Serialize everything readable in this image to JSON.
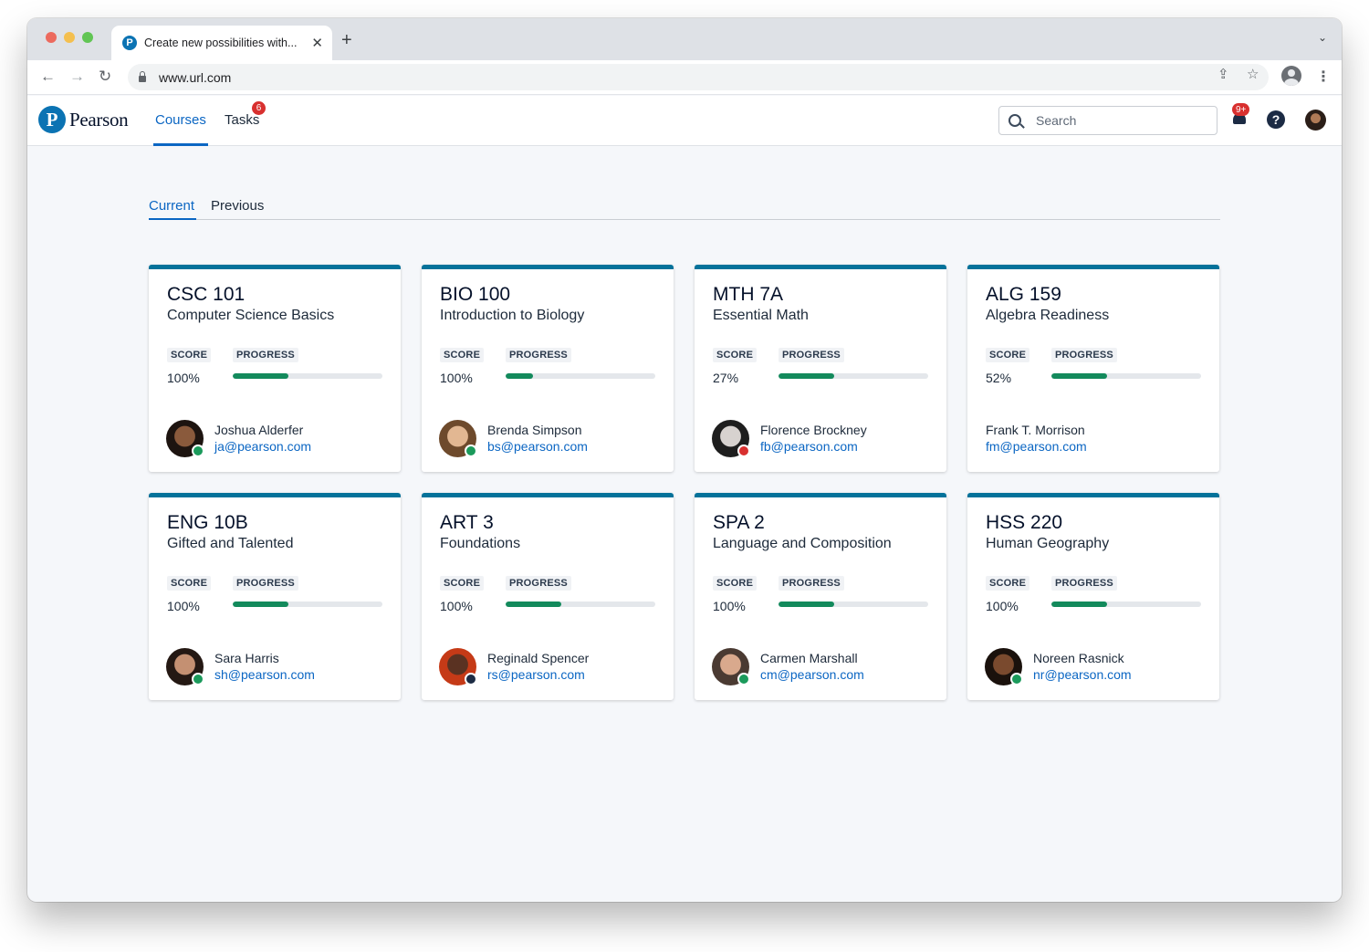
{
  "browser": {
    "tab_title": "Create new possibilities with...",
    "favicon_letter": "P",
    "url": "www.url.com"
  },
  "app": {
    "logo_mark": "P",
    "logo_text": "Pearson",
    "nav": {
      "courses": "Courses",
      "tasks": "Tasks",
      "tasks_badge": "6"
    },
    "search_placeholder": "Search",
    "notifications_badge": "9+",
    "help_glyph": "?"
  },
  "subtabs": {
    "current": "Current",
    "previous": "Previous"
  },
  "labels": {
    "score": "SCORE",
    "progress": "PROGRESS"
  },
  "colors": {
    "accent": "#0b66c3",
    "card_top": "#04729a",
    "progress": "#138a5c",
    "status_online": "#1b9a5b",
    "status_busy": "#d8302f",
    "status_away": "#1c2b44"
  },
  "courses": [
    {
      "code": "CSC 101",
      "name": "Computer Science Basics",
      "score": "100%",
      "progress": 0.37,
      "instructor": "Joshua Alderfer",
      "email": "ja@pearson.com",
      "status": "online",
      "avatar_skin": "#8a5a3c",
      "avatar_hair": "#1d1410"
    },
    {
      "code": "BIO 100",
      "name": "Introduction to Biology",
      "score": "100%",
      "progress": 0.18,
      "instructor": "Brenda Simpson",
      "email": "bs@pearson.com",
      "status": "online",
      "avatar_skin": "#e2b792",
      "avatar_hair": "#6e4a2c"
    },
    {
      "code": "MTH 7A",
      "name": "Essential Math",
      "score": "27%",
      "progress": 0.37,
      "instructor": "Florence Brockney",
      "email": "fb@pearson.com",
      "status": "busy",
      "avatar_skin": "#d7d2cf",
      "avatar_hair": "#1e1e1e"
    },
    {
      "code": "ALG 159",
      "name": "Algebra Readiness",
      "score": "52%",
      "progress": 0.37,
      "instructor": "Frank T. Morrison",
      "email": "fm@pearson.com",
      "status": "none",
      "avatar_skin": "",
      "avatar_hair": ""
    },
    {
      "code": "ENG 10B",
      "name": "Gifted and Talented",
      "score": "100%",
      "progress": 0.37,
      "instructor": "Sara Harris",
      "email": "sh@pearson.com",
      "status": "online",
      "avatar_skin": "#c49072",
      "avatar_hair": "#241813"
    },
    {
      "code": "ART 3",
      "name": "Foundations",
      "score": "100%",
      "progress": 0.37,
      "instructor": "Reginald Spencer",
      "email": "rs@pearson.com",
      "status": "away",
      "avatar_skin": "#5a3222",
      "avatar_hair": "#c53a17"
    },
    {
      "code": "SPA 2",
      "name": "Language and Composition",
      "score": "100%",
      "progress": 0.37,
      "instructor": "Carmen Marshall",
      "email": "cm@pearson.com",
      "status": "online",
      "avatar_skin": "#d9a98d",
      "avatar_hair": "#4a3a32"
    },
    {
      "code": "HSS 220",
      "name": "Human Geography",
      "score": "100%",
      "progress": 0.37,
      "instructor": "Noreen Rasnick",
      "email": "nr@pearson.com",
      "status": "online",
      "avatar_skin": "#7a4a2e",
      "avatar_hair": "#1a110c"
    }
  ]
}
